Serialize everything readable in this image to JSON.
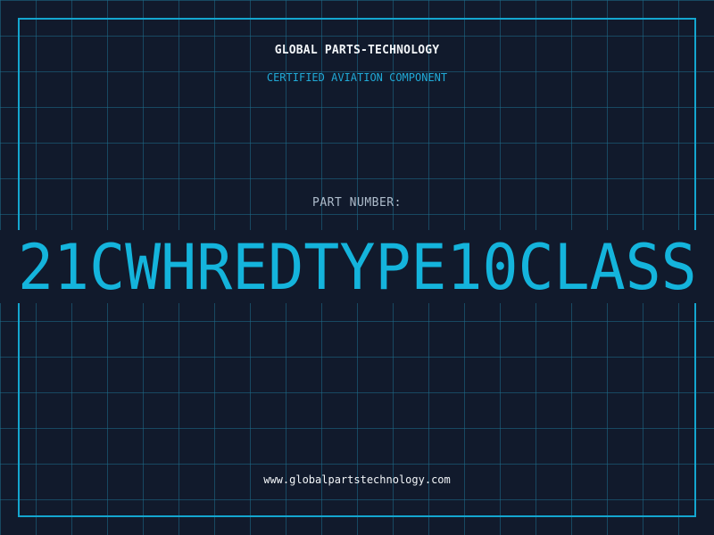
{
  "header": {
    "company": "GLOBAL PARTS-TECHNOLOGY",
    "subtitle": "CERTIFIED AVIATION COMPONENT"
  },
  "part": {
    "label": "PART NUMBER:",
    "number": "21CWHREDTYPE10CLASS"
  },
  "footer": {
    "website": "www.globalpartstechnology.com"
  },
  "colors": {
    "background": "#111a2c",
    "grid": "#1e6e8c",
    "accent": "#14a6cf",
    "text_light": "#f2f5f8",
    "label_gray": "#aebccb"
  }
}
